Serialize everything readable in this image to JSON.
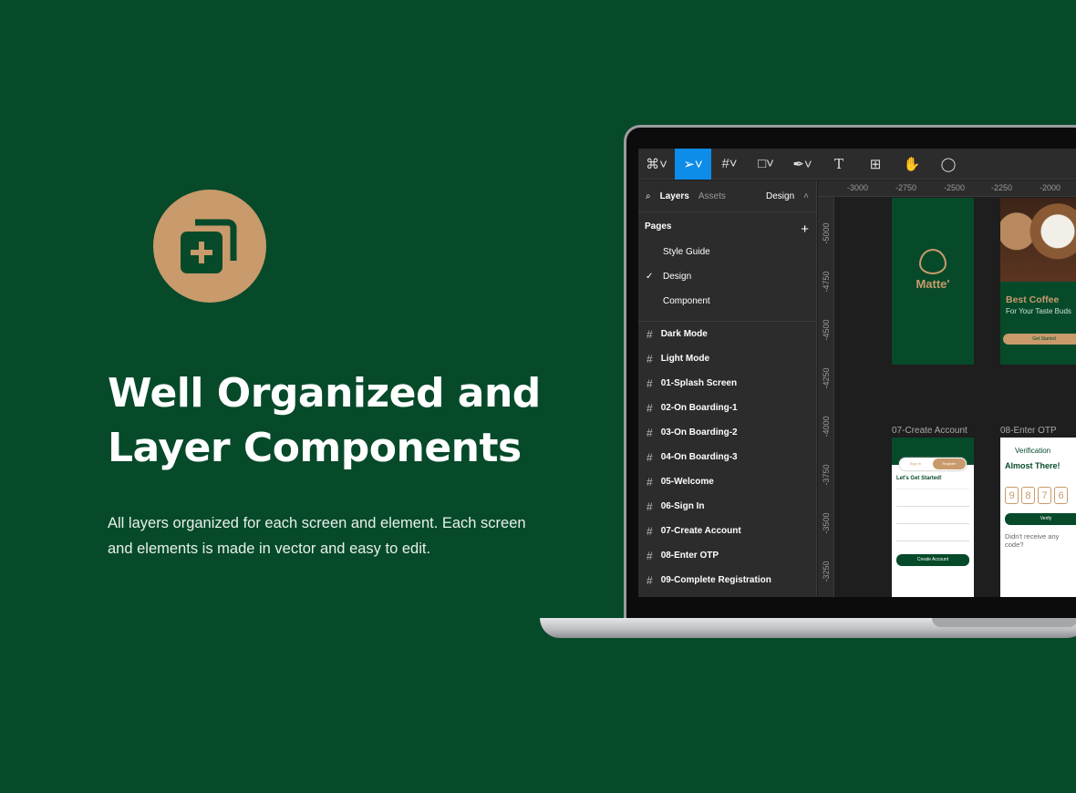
{
  "hero": {
    "icon": "add-layer-icon",
    "title": "Well Organized and Layer Components",
    "description": "All layers organized for each screen and element. Each screen and elements is made in vector and easy to edit."
  },
  "colors": {
    "background": "#064a2a",
    "accent": "#c99a6b",
    "figma_blue": "#0d8ce9"
  },
  "figma": {
    "tabs": {
      "layers": "Layers",
      "assets": "Assets",
      "design": "Design"
    },
    "pages_title": "Pages",
    "pages": [
      "Style Guide",
      "Design",
      "Component"
    ],
    "current_page": "Design",
    "layers": [
      "Dark Mode",
      "Light Mode",
      "01-Splash Screen",
      "02-On Boarding-1",
      "03-On Boarding-2",
      "04-On Boarding-3",
      "05-Welcome",
      "06-Sign In",
      "07-Create Account",
      "08-Enter OTP",
      "09-Complete Registration"
    ],
    "hruler": [
      "-3000",
      "-2750",
      "-2500",
      "-2250",
      "-2000"
    ],
    "vruler": [
      "-5000",
      "-4750",
      "-4500",
      "-4250",
      "-4000",
      "-3750",
      "-3500",
      "-3250"
    ],
    "frames": {
      "splash": {
        "brand": "Matte'"
      },
      "onboarding": {
        "title": "Best Coffee",
        "subtitle": "For Your Taste Buds",
        "button": "Get Started"
      },
      "create": {
        "label": "07-Create Account",
        "signin": "Sign In",
        "register": "Register",
        "heading": "Let's Get Started!",
        "button": "Create Account"
      },
      "otp": {
        "label": "08-Enter OTP",
        "header": "Verification",
        "heading": "Almost There!",
        "digits": [
          "9",
          "8",
          "7",
          "6"
        ],
        "button": "Verify",
        "resend": "Didn't receive any code?"
      }
    }
  }
}
